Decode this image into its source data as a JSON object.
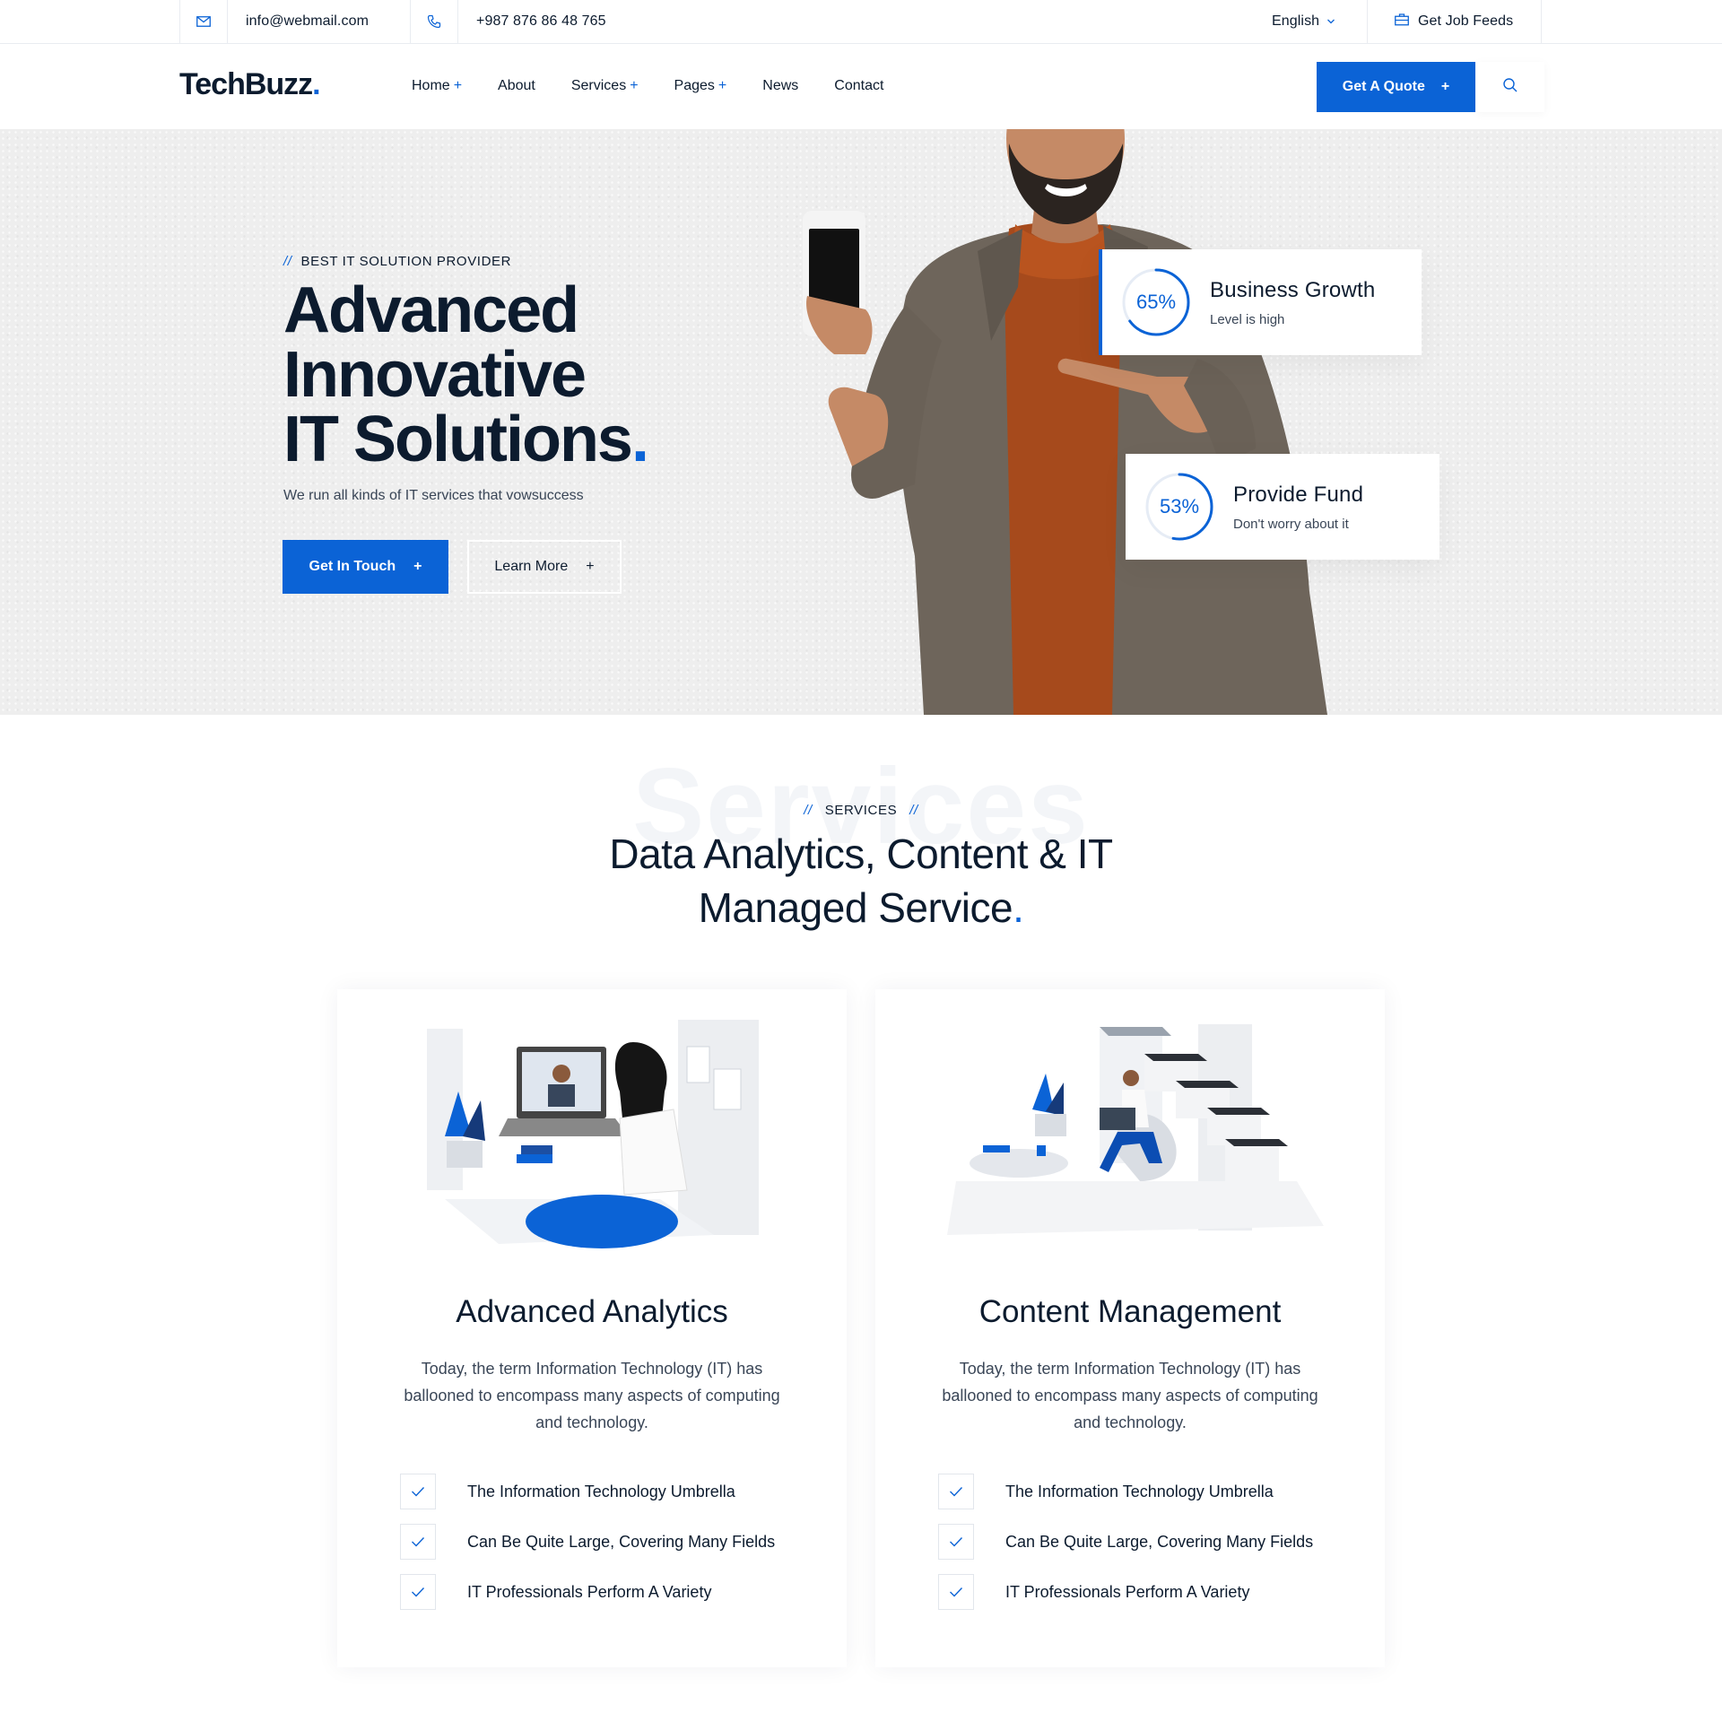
{
  "topbar": {
    "email": "info@webmail.com",
    "phone": "+987 876 86 48 765",
    "language": "English",
    "job_feeds": "Get Job Feeds"
  },
  "header": {
    "logo_text": "TechBuzz",
    "logo_dot": ".",
    "nav": [
      {
        "label": "Home",
        "plus": "+"
      },
      {
        "label": "About",
        "plus": ""
      },
      {
        "label": "Services",
        "plus": "+"
      },
      {
        "label": "Pages",
        "plus": "+"
      },
      {
        "label": "News",
        "plus": ""
      },
      {
        "label": "Contact",
        "plus": ""
      }
    ],
    "quote_label": "Get A Quote",
    "quote_plus": "+"
  },
  "hero": {
    "eyebrow_slash": "//",
    "eyebrow": "BEST IT SOLUTION PROVIDER",
    "title_line1": "Advanced",
    "title_line2": "Innovative",
    "title_line3": "IT Solutions",
    "title_dot": ".",
    "subtitle": "We run all kinds of IT services that vowsuccess",
    "primary_btn": "Get In Touch",
    "secondary_btn": "Learn More",
    "btn_plus": "+",
    "stats": [
      {
        "percent_label": "65%",
        "value": 0.65,
        "title": "Business Growth",
        "sub": "Level is high"
      },
      {
        "percent_label": "53%",
        "value": 0.53,
        "title": "Provide Fund",
        "sub": "Don't worry about it"
      }
    ]
  },
  "services": {
    "bg_word": "Services",
    "eyebrow_slash": "//",
    "eyebrow": "SERVICES",
    "title_line1": "Data Analytics, Content & IT",
    "title_line2": "Managed Service",
    "title_dot": ".",
    "cards": [
      {
        "title": "Advanced Analytics",
        "desc": "Today, the term Information Technology (IT) has ballooned to encompass many aspects of computing and technology.",
        "features": [
          "The Information Technology Umbrella",
          "Can Be Quite Large, Covering Many Fields",
          "IT Professionals Perform A Variety"
        ]
      },
      {
        "title": "Content Management",
        "desc": "Today, the term Information Technology (IT) has ballooned to encompass many aspects of computing and technology.",
        "features": [
          "The Information Technology Umbrella",
          "Can Be Quite Large, Covering Many Fields",
          "IT Professionals Perform A Variety"
        ]
      }
    ]
  },
  "colors": {
    "accent": "#0b63d6",
    "dark": "#0c1b2e",
    "hero_bg": "#eeeeee"
  }
}
